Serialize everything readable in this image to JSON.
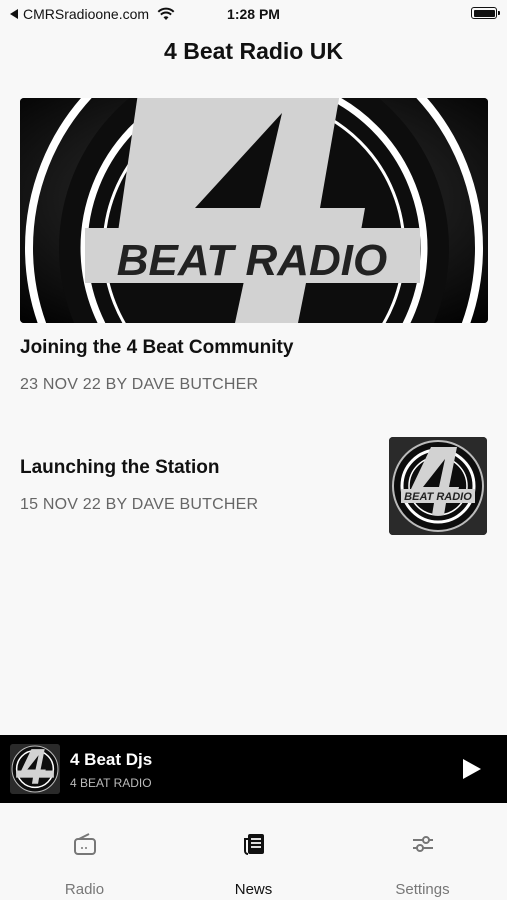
{
  "status_bar": {
    "back_label": "CMRSradioone.com",
    "time": "1:28 PM"
  },
  "header": {
    "title": "4 Beat Radio UK"
  },
  "articles": [
    {
      "title": "Joining the 4 Beat Community",
      "meta": "23 NOV 22 BY DAVE BUTCHER"
    },
    {
      "title": "Launching the Station",
      "meta": "15 NOV 22 BY DAVE BUTCHER"
    }
  ],
  "logo_text": "BEAT RADIO",
  "player": {
    "title": "4 Beat Djs",
    "subtitle": "4 BEAT RADIO"
  },
  "tabs": [
    {
      "label": "Radio",
      "icon": "radio-icon"
    },
    {
      "label": "News",
      "icon": "news-icon"
    },
    {
      "label": "Settings",
      "icon": "sliders-icon"
    }
  ],
  "active_tab": "News"
}
